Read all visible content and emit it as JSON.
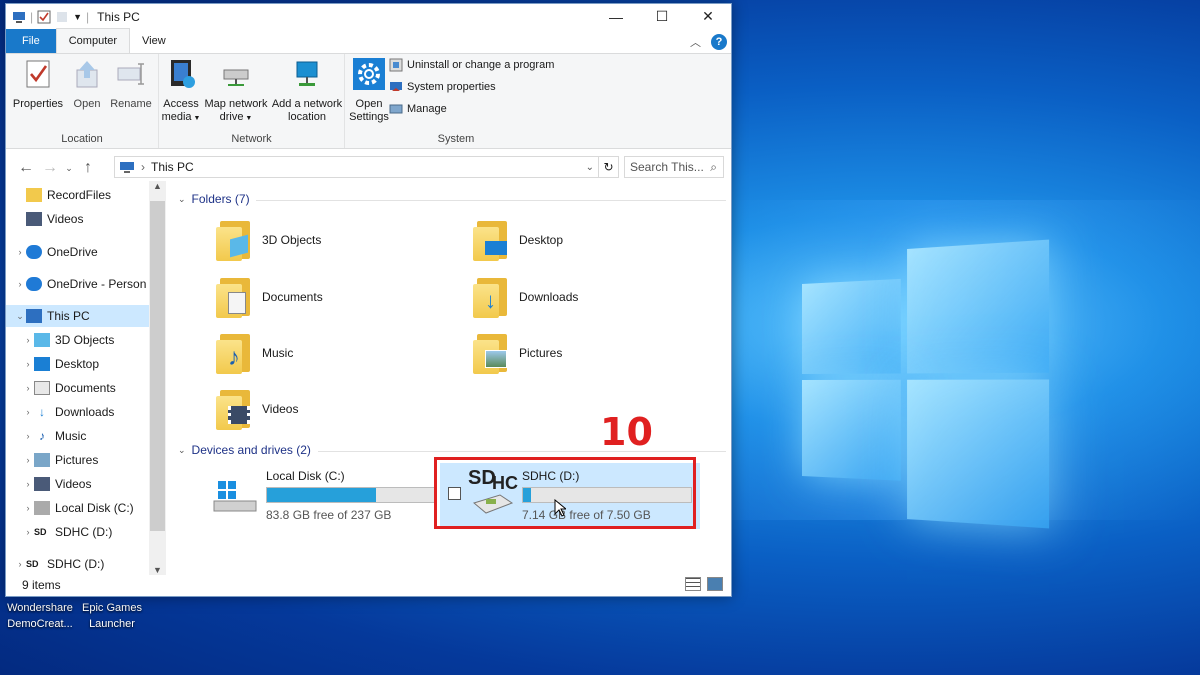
{
  "window": {
    "title": "This PC"
  },
  "ribbon": {
    "tabs": [
      "File",
      "Computer",
      "View"
    ],
    "location": {
      "label": "Location",
      "buttons": [
        "Properties",
        "Open",
        "Rename"
      ]
    },
    "network": {
      "label": "Network",
      "buttons": [
        {
          "line1": "Access",
          "line2": "media"
        },
        {
          "line1": "Map network",
          "line2": "drive"
        },
        {
          "line1": "Add a network",
          "line2": "location"
        }
      ]
    },
    "system": {
      "label": "System",
      "open_settings": {
        "line1": "Open",
        "line2": "Settings"
      },
      "items": [
        "Uninstall or change a program",
        "System properties",
        "Manage"
      ]
    }
  },
  "address": {
    "path": "This PC",
    "search_placeholder": "Search This..."
  },
  "nav": [
    {
      "label": "RecordFiles",
      "icon": "folder-icon"
    },
    {
      "label": "Videos",
      "icon": "videos-icon"
    },
    {
      "label": "OneDrive",
      "icon": "onedrive-icon"
    },
    {
      "label": "OneDrive - Person",
      "icon": "onedrive-icon"
    },
    {
      "label": "This PC",
      "icon": "computer-icon",
      "selected": true
    },
    {
      "label": "3D Objects",
      "icon": "3d-objects-icon"
    },
    {
      "label": "Desktop",
      "icon": "desktop-icon"
    },
    {
      "label": "Documents",
      "icon": "documents-icon"
    },
    {
      "label": "Downloads",
      "icon": "downloads-icon"
    },
    {
      "label": "Music",
      "icon": "music-icon"
    },
    {
      "label": "Pictures",
      "icon": "pictures-icon"
    },
    {
      "label": "Videos",
      "icon": "videos-icon"
    },
    {
      "label": "Local Disk (C:)",
      "icon": "drive-icon"
    },
    {
      "label": "SDHC (D:)",
      "icon": "sdhc-icon"
    },
    {
      "label": "SDHC (D:)",
      "icon": "sdhc-icon"
    }
  ],
  "folders": {
    "header": "Folders (7)",
    "items": [
      "3D Objects",
      "Desktop",
      "Documents",
      "Downloads",
      "Music",
      "Pictures",
      "Videos"
    ]
  },
  "devices": {
    "header": "Devices and drives (2)",
    "items": [
      {
        "name": "Local Disk (C:)",
        "free_text": "83.8 GB free of 237 GB",
        "used_fraction": 0.646
      },
      {
        "name": "SDHC (D:)",
        "free_text": "7.14 GB free of 7.50 GB",
        "used_fraction": 0.048
      }
    ]
  },
  "status": {
    "items": "9 items"
  },
  "annotation": {
    "number": "10",
    "color": "#e02020"
  },
  "desktop_icons": [
    {
      "line1": "Wondershare",
      "line2": "DemoCreat..."
    },
    {
      "line1": "Epic Games",
      "line2": "Launcher"
    }
  ],
  "colors": {
    "accent": "#1979ca",
    "selection": "#cce8ff",
    "drive_bar": "#26a0da"
  }
}
